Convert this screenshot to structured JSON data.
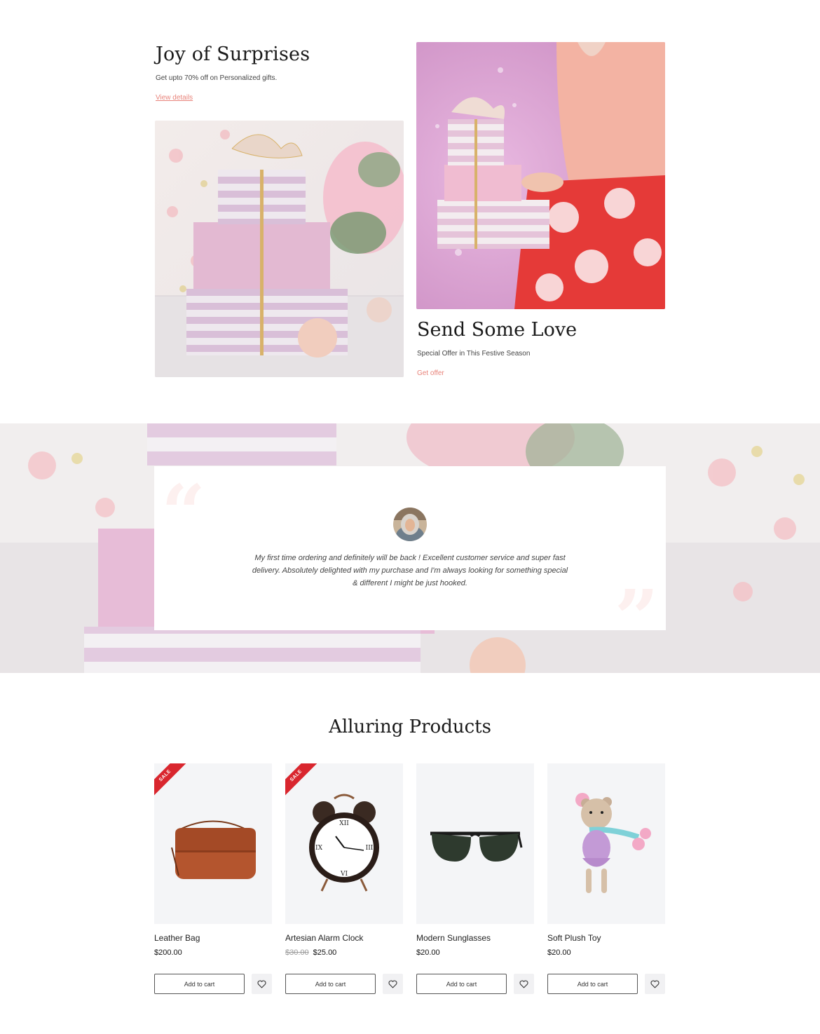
{
  "hero": {
    "title": "Joy of Surprises",
    "subtitle": "Get upto 70% off on Personalized gifts.",
    "link": "View details"
  },
  "promo": {
    "title": "Send Some Love",
    "subtitle": "Special Offer in This Festive Season",
    "link": "Get offer"
  },
  "testimonial": {
    "line1": "My first time ordering and definitely will be back ! Excellent customer service and super fast",
    "line2": "delivery. Absolutely delighted with my purchase and I'm always looking for something special",
    "line3": "& different I might be just hooked."
  },
  "products_section": {
    "title": "Alluring Products",
    "items": [
      {
        "name": "Leather Bag",
        "price": "$200.00",
        "old_price": "",
        "sale": true,
        "sale_label": "SALE",
        "button": "Add to cart",
        "icon": "leather-bag"
      },
      {
        "name": "Artesian Alarm Clock",
        "price": "$25.00",
        "old_price": "$30.00",
        "sale": true,
        "sale_label": "SALE",
        "button": "Add to cart",
        "icon": "alarm-clock"
      },
      {
        "name": "Modern Sunglasses",
        "price": "$20.00",
        "old_price": "",
        "sale": false,
        "button": "Add to cart",
        "icon": "sunglasses"
      },
      {
        "name": "Soft Plush Toy",
        "price": "$20.00",
        "old_price": "",
        "sale": false,
        "button": "Add to cart",
        "icon": "plush-toy"
      }
    ]
  },
  "colors": {
    "accent": "#e8837a",
    "sale": "#d9262e",
    "card_bg": "#f4f5f7"
  }
}
